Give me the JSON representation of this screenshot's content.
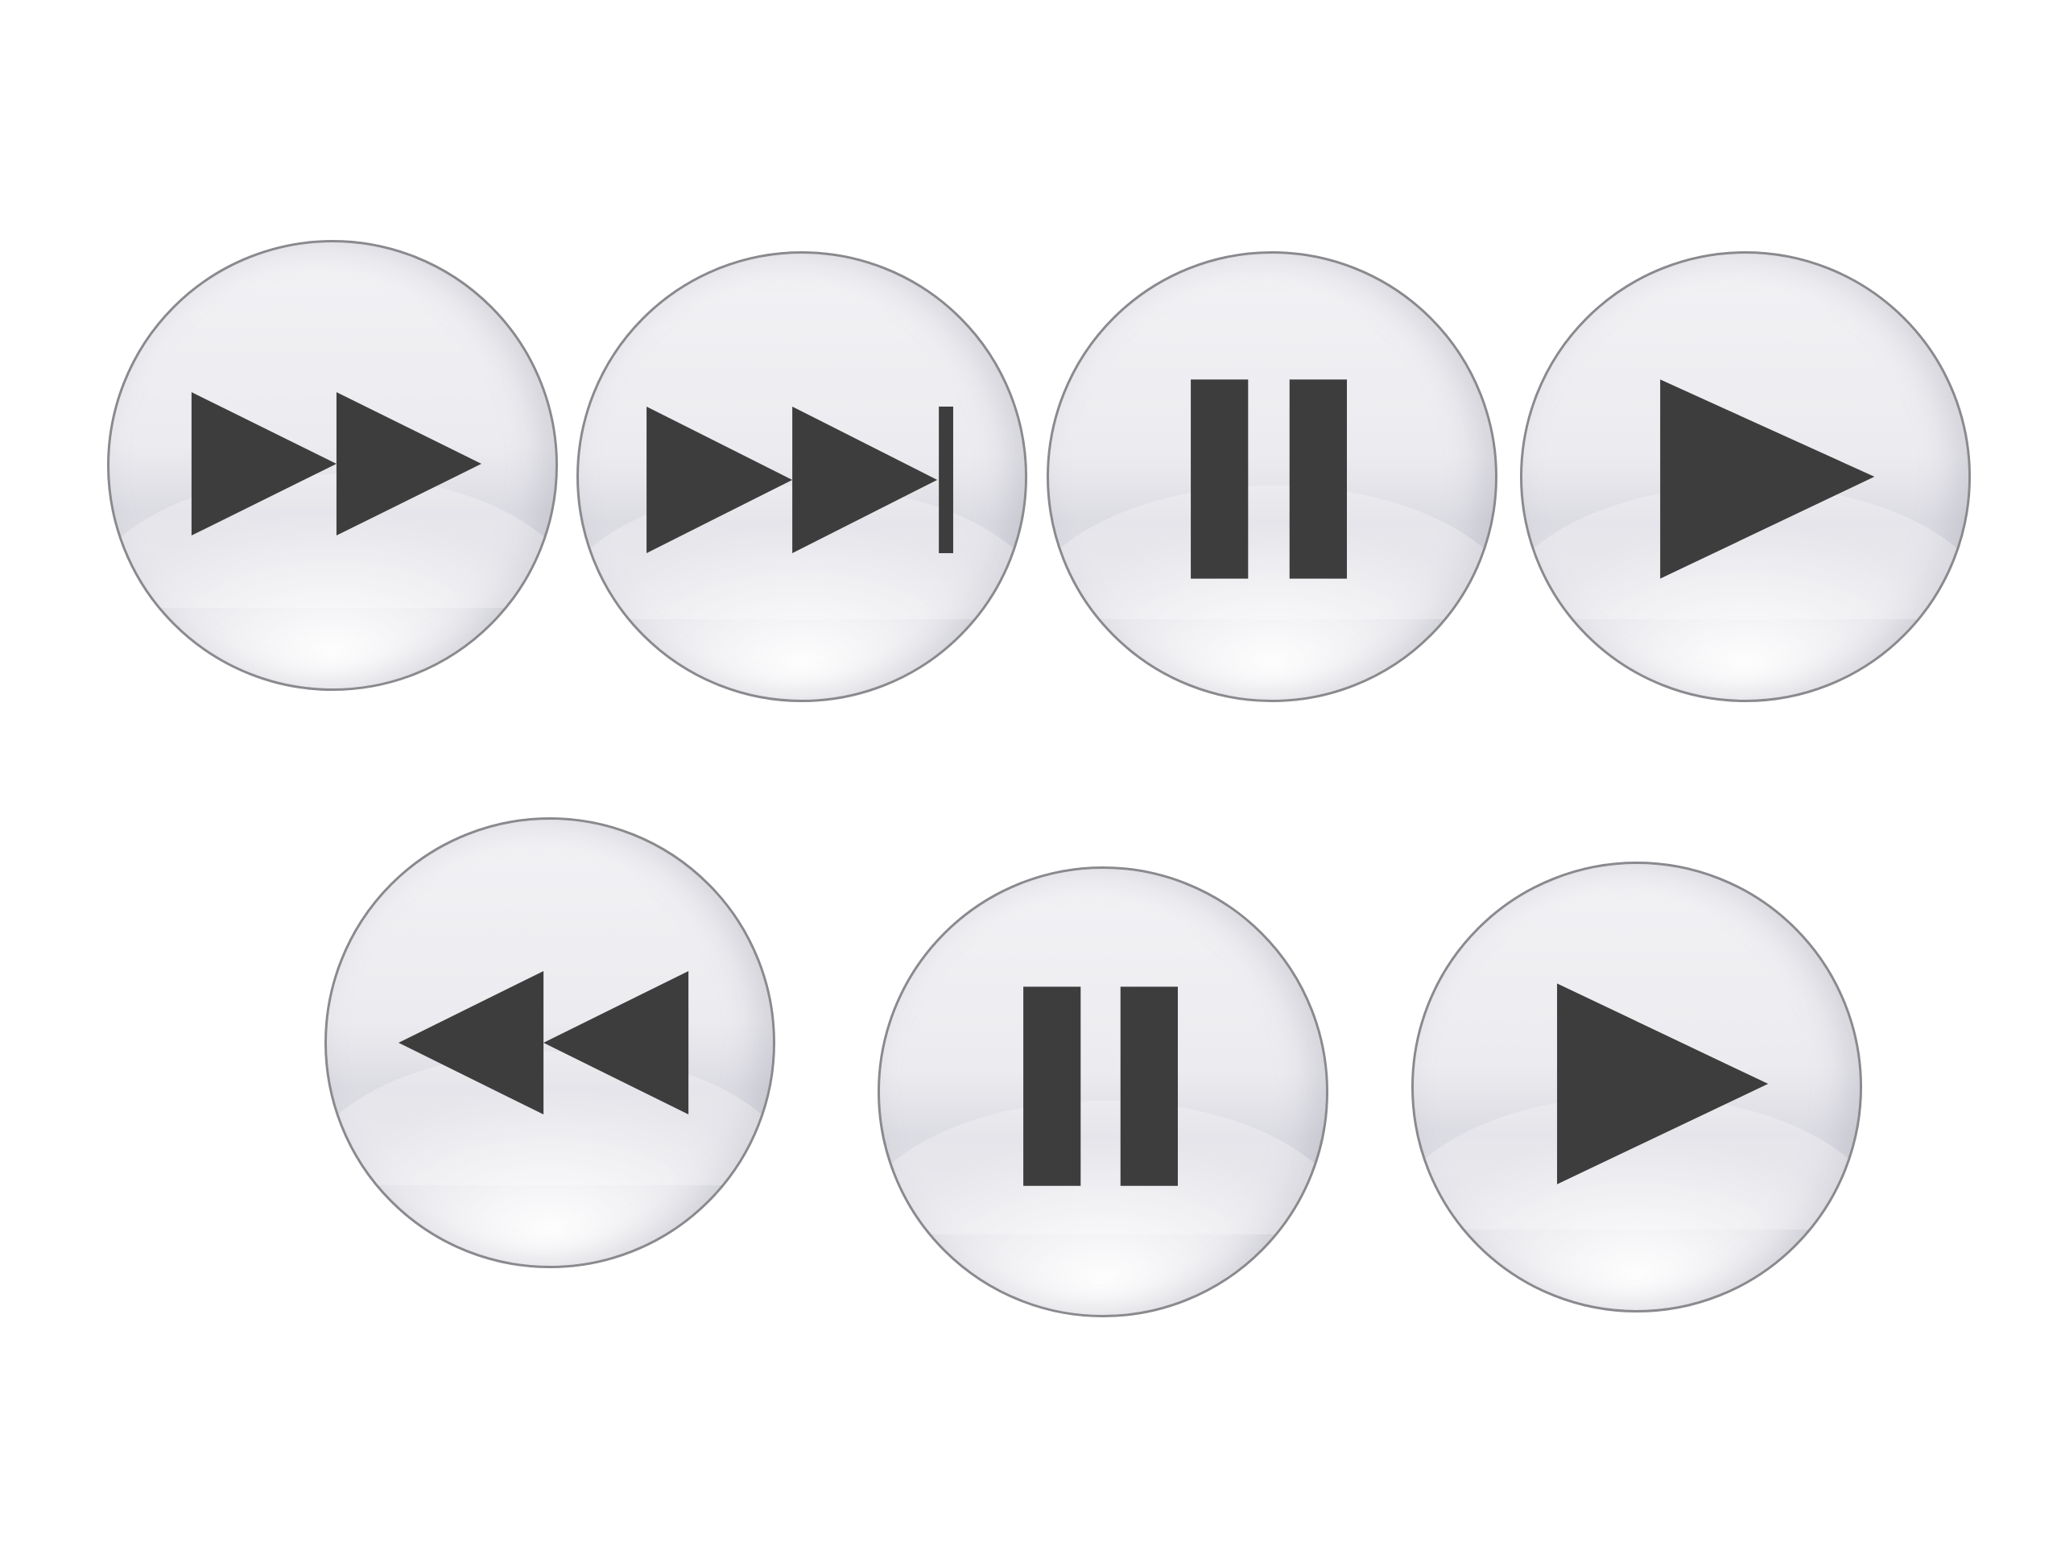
{
  "controls": [
    {
      "id": "fast-forward",
      "icon": "fast-forward-icon"
    },
    {
      "id": "skip-forward",
      "icon": "skip-forward-icon"
    },
    {
      "id": "pause",
      "icon": "pause-icon"
    },
    {
      "id": "play",
      "icon": "play-icon"
    },
    {
      "id": "rewind",
      "icon": "rewind-icon"
    },
    {
      "id": "pause",
      "icon": "pause-icon"
    },
    {
      "id": "play",
      "icon": "play-icon"
    }
  ],
  "colors": {
    "glyph": "#3d3d3d",
    "button_border": "#8a8a8e",
    "button_face": "#ececf0",
    "background": "#ffffff"
  }
}
